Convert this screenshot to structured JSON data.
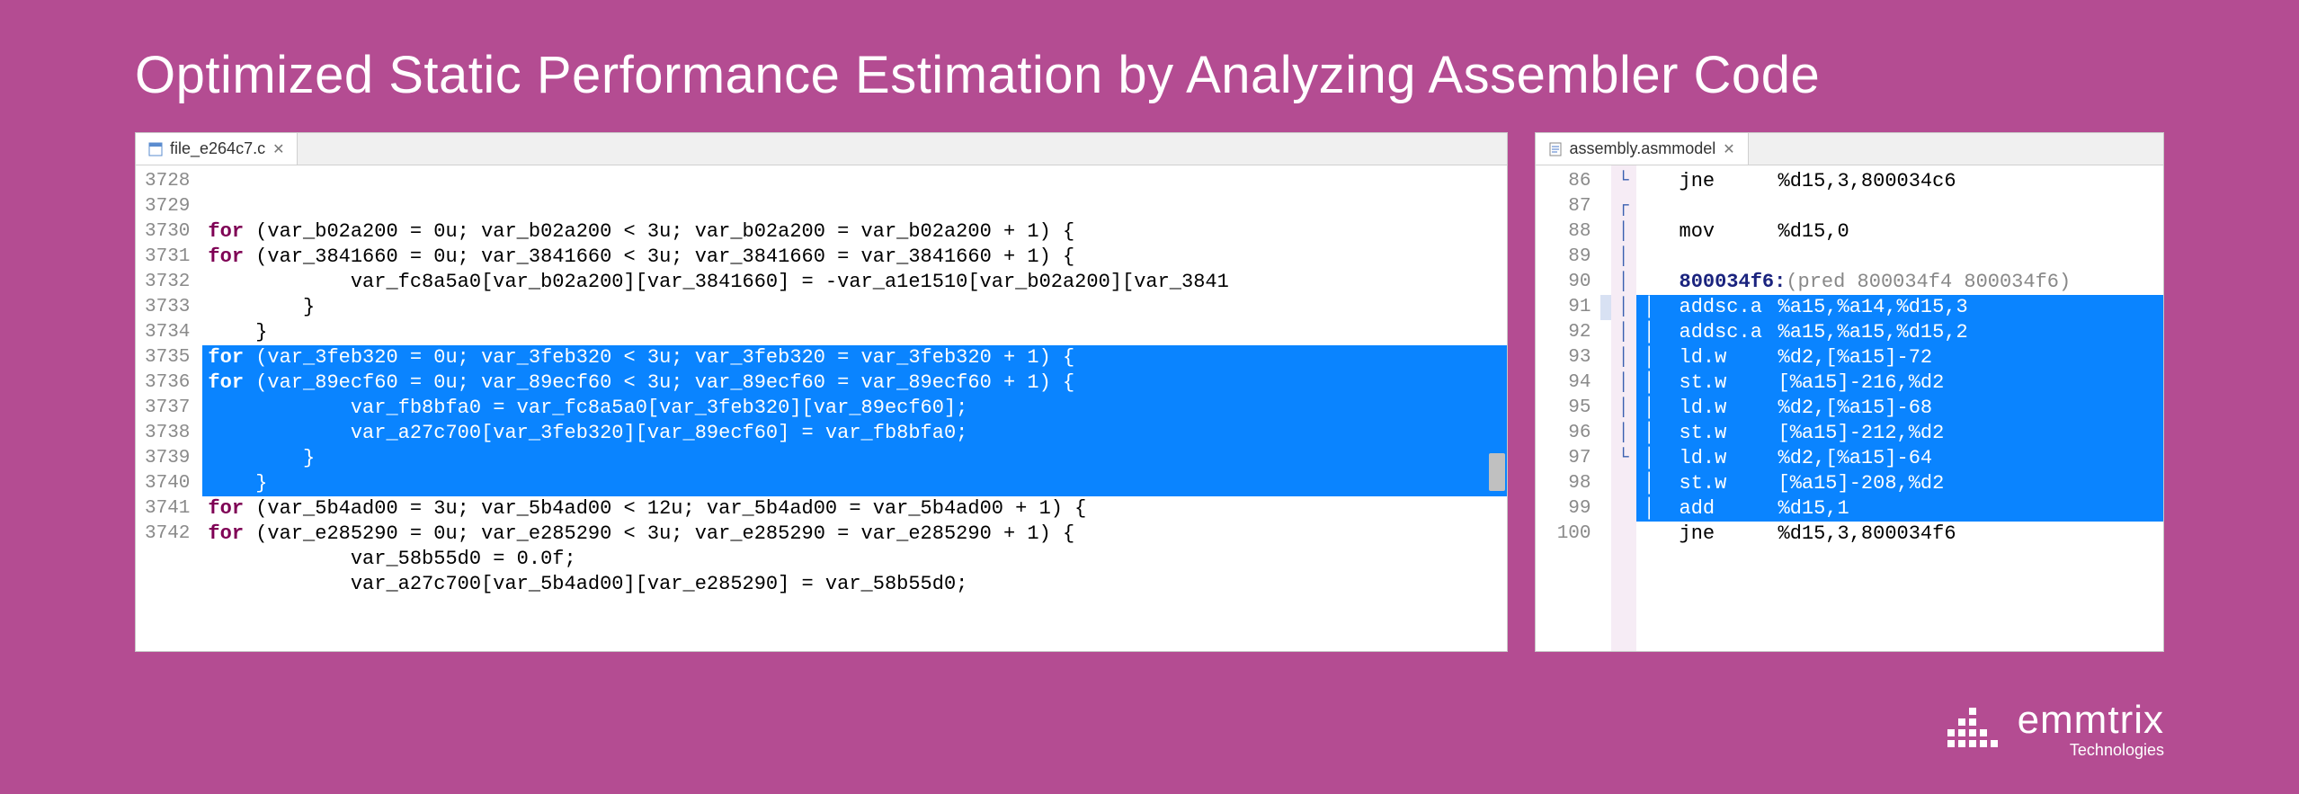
{
  "headline": "Optimized Static Performance Estimation by Analyzing Assembler Code",
  "left": {
    "tab": "file_e264c7.c",
    "gutter_start": 3728,
    "lines": [
      {
        "sel": false,
        "indent": 1,
        "text": "for (var_b02a200 = 0u; var_b02a200 < 3u; var_b02a200 = var_b02a200 + 1) {"
      },
      {
        "sel": false,
        "indent": 2,
        "text": "for (var_3841660 = 0u; var_3841660 < 3u; var_3841660 = var_3841660 + 1) {"
      },
      {
        "sel": false,
        "indent": 3,
        "text": "var_fc8a5a0[var_b02a200][var_3841660] = -var_a1e1510[var_b02a200][var_3841"
      },
      {
        "sel": false,
        "indent": 2,
        "text": "}"
      },
      {
        "sel": false,
        "indent": 1,
        "text": "}"
      },
      {
        "sel": true,
        "indent": 1,
        "text": "for (var_3feb320 = 0u; var_3feb320 < 3u; var_3feb320 = var_3feb320 + 1) {"
      },
      {
        "sel": true,
        "indent": 2,
        "text": "for (var_89ecf60 = 0u; var_89ecf60 < 3u; var_89ecf60 = var_89ecf60 + 1) {"
      },
      {
        "sel": true,
        "indent": 3,
        "text": "var_fb8bfa0 = var_fc8a5a0[var_3feb320][var_89ecf60];"
      },
      {
        "sel": true,
        "indent": 3,
        "text": "var_a27c700[var_3feb320][var_89ecf60] = var_fb8bfa0;"
      },
      {
        "sel": true,
        "indent": 2,
        "text": "}"
      },
      {
        "sel": true,
        "indent": 1,
        "text": "}"
      },
      {
        "sel": false,
        "indent": 1,
        "text": "for (var_5b4ad00 = 3u; var_5b4ad00 < 12u; var_5b4ad00 = var_5b4ad00 + 1) {"
      },
      {
        "sel": false,
        "indent": 2,
        "text": "for (var_e285290 = 0u; var_e285290 < 3u; var_e285290 = var_e285290 + 1) {"
      },
      {
        "sel": false,
        "indent": 3,
        "text": "var_58b55d0 = 0.0f;"
      },
      {
        "sel": false,
        "indent": 3,
        "text": "var_a27c700[var_5b4ad00][var_e285290] = var_58b55d0;"
      }
    ]
  },
  "right": {
    "tab": "assembly.asmmodel",
    "gutter_start": 86,
    "lines": [
      {
        "sel": false,
        "fold": "└",
        "pipe": "",
        "mn": "jne",
        "op": "%d15,3,800034c6"
      },
      {
        "sel": false,
        "fold": "",
        "pipe": "",
        "mn": "",
        "op": ""
      },
      {
        "sel": false,
        "fold": "",
        "pipe": "",
        "mn": "mov",
        "op": "%d15,0"
      },
      {
        "sel": false,
        "fold": "",
        "pipe": "",
        "mn": "",
        "op": ""
      },
      {
        "sel": false,
        "fold": "┌",
        "pipe": "",
        "addr": "800034f6:",
        "pred": "(pred 800034f4 800034f6)"
      },
      {
        "sel": true,
        "fold": "│",
        "pipe": "│",
        "mn": "addsc.a",
        "op": "%a15,%a14,%d15,3",
        "mark": true
      },
      {
        "sel": true,
        "fold": "│",
        "pipe": "│",
        "mn": "addsc.a",
        "op": "%a15,%a15,%d15,2"
      },
      {
        "sel": true,
        "fold": "│",
        "pipe": "│",
        "mn": "ld.w",
        "op": "%d2,[%a15]-72"
      },
      {
        "sel": true,
        "fold": "│",
        "pipe": "│",
        "mn": "st.w",
        "op": "[%a15]-216,%d2"
      },
      {
        "sel": true,
        "fold": "│",
        "pipe": "│",
        "mn": "ld.w",
        "op": "%d2,[%a15]-68"
      },
      {
        "sel": true,
        "fold": "│",
        "pipe": "│",
        "mn": "st.w",
        "op": "[%a15]-212,%d2"
      },
      {
        "sel": true,
        "fold": "│",
        "pipe": "│",
        "mn": "ld.w",
        "op": "%d2,[%a15]-64"
      },
      {
        "sel": true,
        "fold": "│",
        "pipe": "│",
        "mn": "st.w",
        "op": "[%a15]-208,%d2"
      },
      {
        "sel": true,
        "fold": "│",
        "pipe": "│",
        "mn": "add",
        "op": "%d15,1"
      },
      {
        "sel": false,
        "fold": "└",
        "pipe": "",
        "mn": "jne",
        "op": "%d15,3,800034f6"
      }
    ]
  },
  "logo": {
    "brand": "emmtrix",
    "sub": "Technologies"
  }
}
